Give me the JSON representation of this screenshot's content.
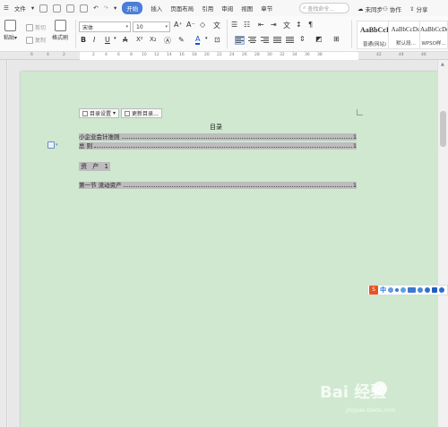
{
  "menubar": {
    "file_menu": "文件",
    "tabs": [
      "开始",
      "插入",
      "页面布局",
      "引用",
      "审阅",
      "视图",
      "章节"
    ],
    "search_placeholder": "查找命令...",
    "sync": "未同步",
    "collab": "协作",
    "share": "分享"
  },
  "ribbon": {
    "paste": "粘贴",
    "cut": "剪切",
    "copy": "复制",
    "format_painter": "格式刷",
    "font_name": "宋体",
    "font_size": "10",
    "bold": "B",
    "italic": "I",
    "underline": "U",
    "strikethrough": "A",
    "superscript": "X²",
    "subscript": "X₂",
    "font_color": "A",
    "styles": [
      {
        "preview": "AaBbCcI",
        "name": "普通(网站)"
      },
      {
        "preview": "AaBbCcDd",
        "name": "默认段..."
      },
      {
        "preview": "AaBbCcDd",
        "name": "WPSO样..."
      }
    ]
  },
  "ruler": {
    "numbers": [
      "6",
      "4",
      "2",
      "2",
      "4",
      "6",
      "8",
      "10",
      "12",
      "14",
      "16",
      "18",
      "20",
      "22",
      "24",
      "26",
      "28",
      "30",
      "32",
      "34",
      "36",
      "38",
      "42",
      "44",
      "46"
    ]
  },
  "toc_tools": {
    "settings": "目录设置",
    "update": "更新目录..."
  },
  "document": {
    "toc_title": "目录",
    "entries": [
      {
        "text": "小企业会计准则",
        "page": "1"
      },
      {
        "text": "总  则",
        "page": "1"
      }
    ],
    "heading": "资  产   1",
    "entry3": {
      "text": "第一节  流动资产",
      "page": "1"
    }
  },
  "ime": {
    "logo": "S",
    "mode": "中"
  },
  "watermark": {
    "brand": "Bai  经验",
    "url": "jingyan.baidu.com"
  },
  "colors": {
    "page_bg": "#cfe8cf",
    "accent": "#4a7ed8",
    "highlight": "#bdbdbd"
  }
}
